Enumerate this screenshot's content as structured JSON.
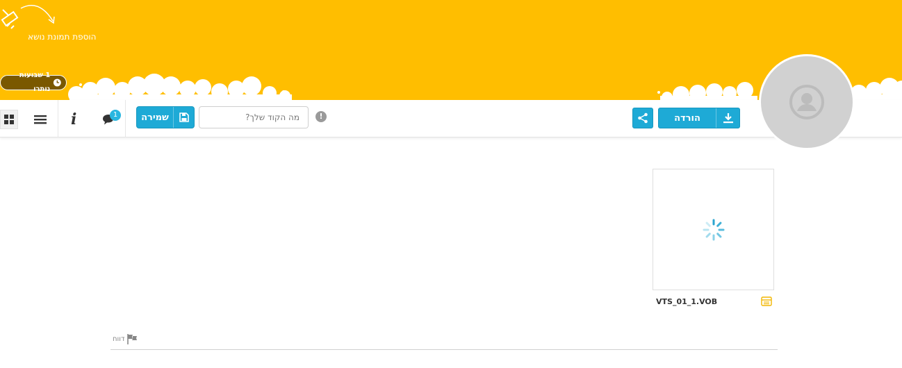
{
  "banner": {
    "add_cover_label": "הוספת תמונת נושא",
    "expiry_label": "1 שבועות נותרו",
    "background_color": "#ffbe00"
  },
  "toolbar": {
    "save_label": "שמירה",
    "code_placeholder": "מה הקוד שלך?",
    "comments_count": "1",
    "info_label": "i",
    "download_label": "הורדה",
    "accent_color": "#1eaad6",
    "icons": [
      "grid-view-icon",
      "menu-icon",
      "info-icon",
      "comments-icon",
      "save-icon",
      "warning-icon",
      "share-icon",
      "download-icon"
    ]
  },
  "file": {
    "name": "VTS_01_1.VOB",
    "type_icon": "video-file-icon",
    "state": "loading"
  },
  "footer": {
    "report_label": "דווח",
    "report_icon": "flag-icon"
  },
  "avatar": {
    "icon": "user-avatar-icon"
  }
}
